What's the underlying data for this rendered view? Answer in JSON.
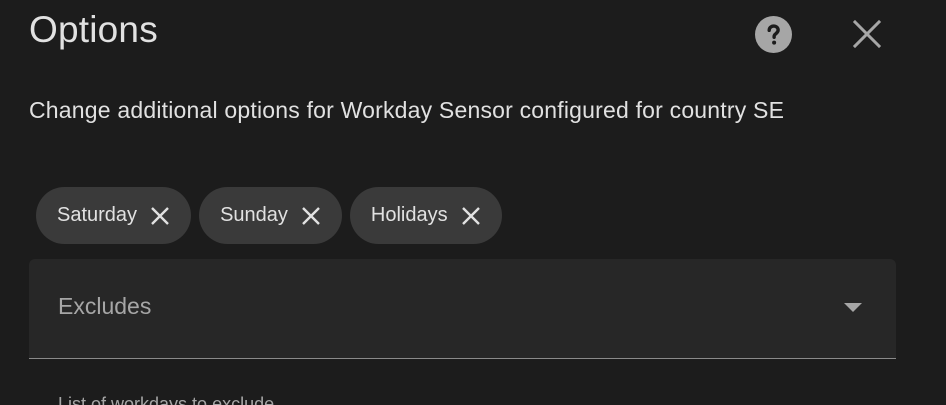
{
  "dialog": {
    "title": "Options",
    "help_icon": "help-circle-icon",
    "close_icon": "close-icon",
    "description": "Change additional options for Workday Sensor configured for country SE"
  },
  "chips": [
    {
      "label": "Saturday",
      "remove_icon": "close-icon"
    },
    {
      "label": "Sunday",
      "remove_icon": "close-icon"
    },
    {
      "label": "Holidays",
      "remove_icon": "close-icon"
    }
  ],
  "excludes_field": {
    "label": "Excludes",
    "arrow_icon": "menu-down-icon",
    "helper": "List of workdays to exclude"
  },
  "colors": {
    "background": "#1c1c1c",
    "chip": "#3a3a3a",
    "field": "#272727",
    "text": "#e1e1e1",
    "muted": "#a6a6a6"
  }
}
